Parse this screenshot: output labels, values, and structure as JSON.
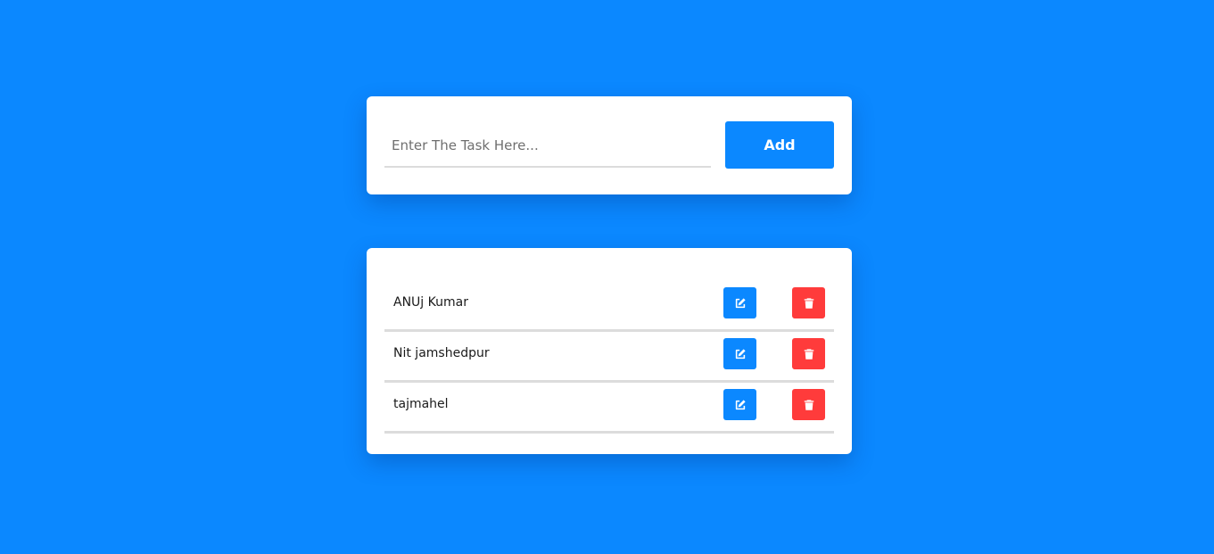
{
  "colors": {
    "background": "#0b88ff",
    "primary": "#0b88ff",
    "danger": "#ff3b3b",
    "card": "#ffffff",
    "divider": "#dcdcdc"
  },
  "input": {
    "placeholder": "Enter The Task Here...",
    "value": ""
  },
  "add_button": {
    "label": "Add"
  },
  "tasks": [
    {
      "text": "ANUj Kumar",
      "edit_icon": "edit-icon",
      "delete_icon": "trash-icon"
    },
    {
      "text": "Nit jamshedpur",
      "edit_icon": "edit-icon",
      "delete_icon": "trash-icon"
    },
    {
      "text": "tajmahel",
      "edit_icon": "edit-icon",
      "delete_icon": "trash-icon"
    }
  ]
}
